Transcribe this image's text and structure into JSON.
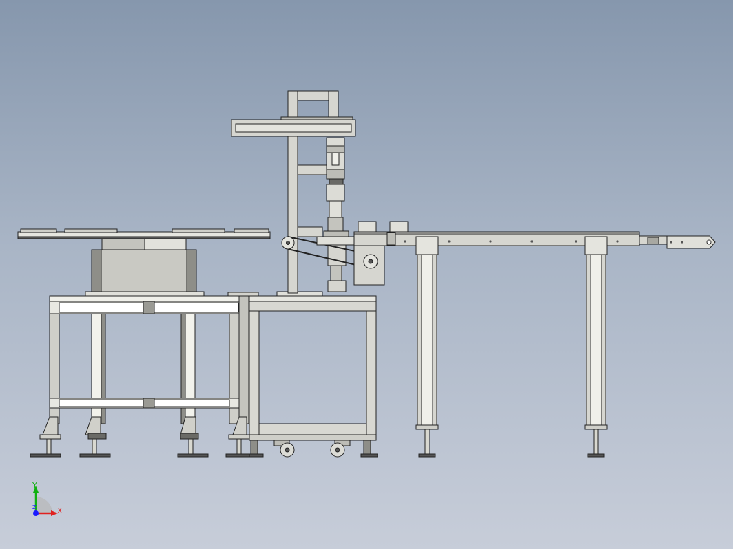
{
  "viewport": {
    "background_top": "#8697ad",
    "background_bottom": "#c7cdd9"
  },
  "model": {
    "part_fill": "#d8d8d0",
    "part_stroke": "#222222",
    "shade_fill": "#a8a8a2",
    "dark_fill": "#6a6a66"
  },
  "triad": {
    "x_label": "X",
    "y_label": "Y",
    "z_label": "Z",
    "x_color": "#e02020",
    "y_color": "#10b010",
    "z_color": "#1a1aff"
  }
}
